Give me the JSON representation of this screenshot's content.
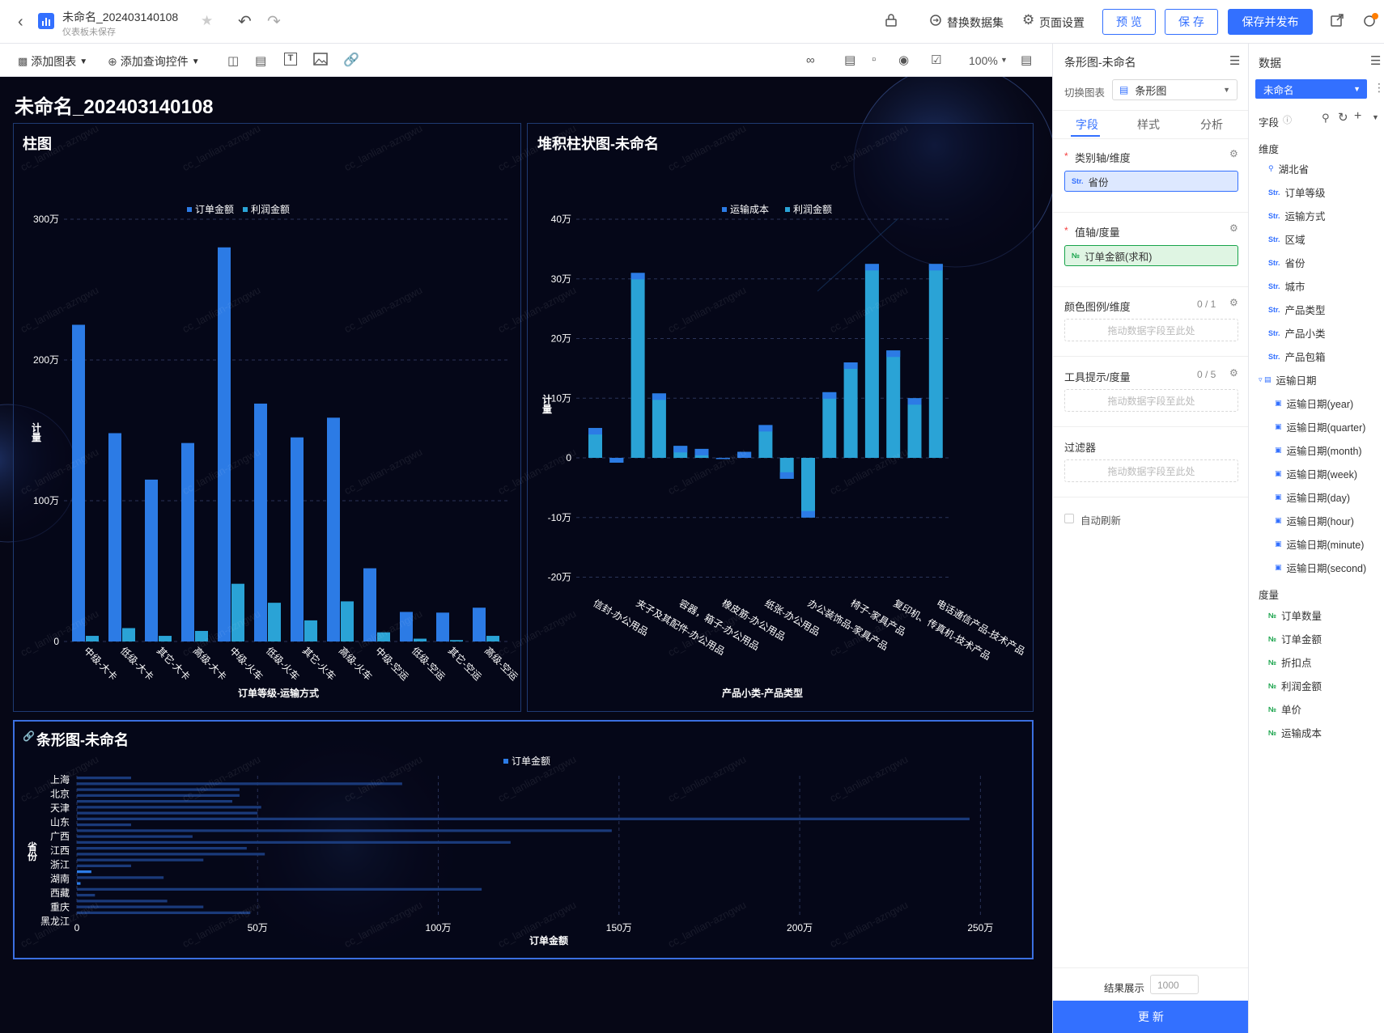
{
  "header": {
    "title": "未命名_202403140108",
    "subtitle": "仪表板未保存",
    "replace_dataset": "替换数据集",
    "page_settings": "页面设置",
    "preview": "预 览",
    "save": "保 存",
    "save_publish": "保存并发布"
  },
  "toolbar": {
    "add_chart": "添加图表",
    "add_query": "添加查询控件",
    "zoom": "100%"
  },
  "dashboard": {
    "title": "未命名_202403140108",
    "watermark": "cc_lanlian-azngwu"
  },
  "chart_data": [
    {
      "type": "bar",
      "title": "柱图",
      "xlabel": "订单等级-运输方式",
      "ylabel": "计量",
      "categories": [
        "中级-大卡",
        "低级-大卡",
        "其它-大卡",
        "高级-大卡",
        "中级-火车",
        "低级-火车",
        "其它-火车",
        "高级-火车",
        "中级-空运",
        "低级-空运",
        "其它-空运",
        "高级-空运"
      ],
      "series": [
        {
          "name": "订单金额",
          "values": [
            2250000,
            1480000,
            1150000,
            1410000,
            2800000,
            1690000,
            1450000,
            1590000,
            520000,
            210000,
            205000,
            240000
          ]
        },
        {
          "name": "利润金额",
          "values": [
            40000,
            95000,
            40000,
            75000,
            410000,
            275000,
            150000,
            285000,
            65000,
            20000,
            10000,
            40000
          ]
        }
      ],
      "yticks": [
        "0",
        "100万",
        "200万",
        "300万"
      ],
      "ylim": [
        0,
        3000000
      ],
      "legend": "top-center",
      "grid": true
    },
    {
      "type": "bar",
      "title": "堆积柱状图-未命名",
      "xlabel": "产品小类-产品类型",
      "ylabel": "计量",
      "stacked": true,
      "categories": [
        "信封-办公用品",
        "夹子及其配件-办公用品",
        "容器，箱子-办公用品",
        "橡皮筋-办公用品",
        "纸张-办公用品",
        "办公装饰品-家具产品",
        "椅子-家具产品",
        "复印机、传真机-技术产品",
        "电话通信产品-技术产品"
      ],
      "series": [
        {
          "name": "运输成本",
          "values": [
            0,
            -1,
            31,
            10.8,
            2,
            1.5,
            0.1,
            1,
            5.5,
            1,
            2,
            11,
            16,
            32.5,
            18,
            10,
            32.5
          ]
        },
        {
          "name": "利润金额",
          "values": [
            5,
            -0.8,
            30,
            10,
            1,
            1.5,
            -0.2,
            0.8,
            4.5,
            -3.5,
            -10,
            10.5,
            14.5,
            31.5,
            17.5,
            9.5,
            31.8
          ]
        }
      ],
      "bar_values_wan": [
        5,
        -0.8,
        31,
        10.8,
        2,
        1.5,
        -0.2,
        1,
        5.5,
        -3.5,
        -10,
        11,
        16,
        32.5,
        18,
        10,
        32.5
      ],
      "yticks": [
        "-20万",
        "-10万",
        "0",
        "10万",
        "20万",
        "30万",
        "40万"
      ],
      "ylim": [
        -20,
        40
      ],
      "legend": "top-center",
      "grid": true
    },
    {
      "type": "bar",
      "orientation": "horizontal",
      "title": "条形图-未命名",
      "xlabel": "订单金额",
      "ylabel": "省份",
      "series": [
        {
          "name": "订单金额",
          "values": [
            15,
            90,
            45,
            45,
            43,
            51,
            50,
            247,
            15,
            148,
            32,
            120,
            47,
            52,
            35,
            15,
            4,
            24,
            1,
            112,
            5,
            25,
            35,
            48
          ]
        }
      ],
      "province_labels": [
        "上海",
        "北京",
        "天津",
        "山东",
        "广西",
        "江西",
        "浙江",
        "湖南",
        "西藏",
        "重庆",
        "黑龙江"
      ],
      "xticks": [
        "0",
        "50万",
        "100万",
        "150万",
        "200万",
        "250万"
      ],
      "xlim": [
        0,
        260
      ],
      "legend": "top-center",
      "grid": true
    }
  ],
  "config_panel": {
    "title": "条形图-未命名",
    "switch_label": "切换图表",
    "chart_type": "条形图",
    "tabs": [
      "字段",
      "样式",
      "分析"
    ],
    "category_axis": "类别轴/维度",
    "category_field": "省份",
    "value_axis": "值轴/度量",
    "value_field": "订单金额(求和)",
    "color_legend": "颜色图例/维度",
    "color_count": "0 / 1",
    "tooltip": "工具提示/度量",
    "tooltip_count": "0 / 5",
    "filter": "过滤器",
    "drop_hint": "拖动数据字段至此处",
    "auto_refresh": "自动刷新",
    "result_label": "结果展示",
    "result_value": "1000",
    "update": "更 新"
  },
  "data_panel": {
    "title": "数据",
    "dataset": "未命名",
    "fields_label": "字段",
    "dimension_label": "维度",
    "dimensions": [
      "湖北省",
      "订单等级",
      "运输方式",
      "区域",
      "省份",
      "城市",
      "产品类型",
      "产品小类",
      "产品包箱",
      "运输日期",
      "运输日期(year)",
      "运输日期(quarter)",
      "运输日期(month)",
      "运输日期(week)",
      "运输日期(day)",
      "运输日期(hour)",
      "运输日期(minute)",
      "运输日期(second)"
    ],
    "measure_label": "度量",
    "measures": [
      "订单数量",
      "订单金额",
      "折扣点",
      "利润金额",
      "单价",
      "运输成本"
    ]
  }
}
